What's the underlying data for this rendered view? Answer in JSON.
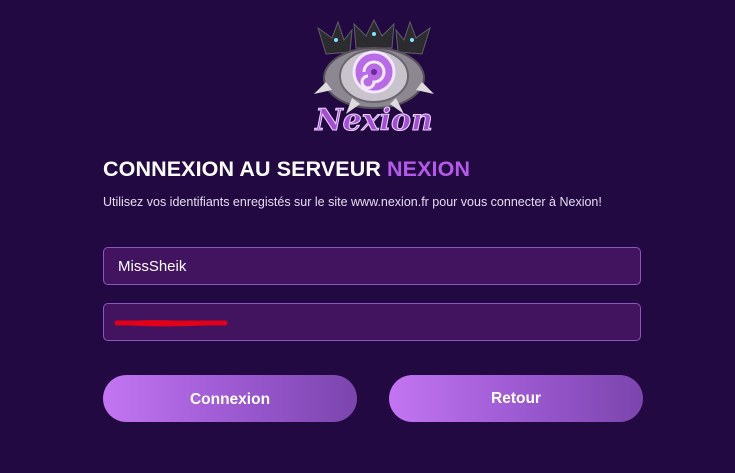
{
  "login": {
    "title_prefix": "CONNEXION AU SERVEUR ",
    "title_accent": "NEXION",
    "subtitle": "Utilisez vos identifiants enregistés sur le site www.nexion.fr pour vous connecter à Nexion!",
    "username_value": "MissSheik",
    "password_value": "••••••••••••",
    "login_button": "Connexion",
    "back_button": "Retour",
    "logo_text": "Nexion"
  },
  "colors": {
    "background": "#230941",
    "accent": "#b35ae9",
    "field_background": "#421460",
    "field_border": "#8d55c1",
    "redaction": "#e0001a"
  }
}
